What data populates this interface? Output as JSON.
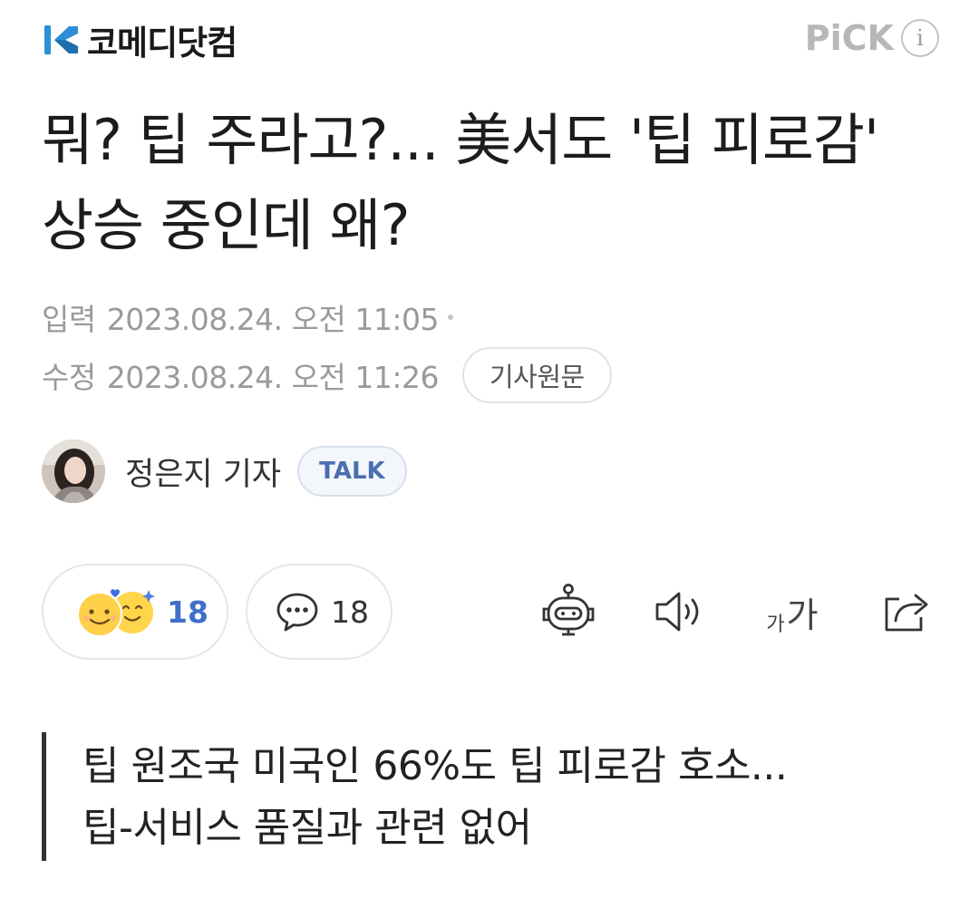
{
  "header": {
    "press_name": "코메디닷컴",
    "pick_label": "PiCK",
    "info_label": "i",
    "brand_color": "#2d8fd5"
  },
  "article": {
    "title": "뭐? 팁 주라고?... 美서도 '팁 피로감' 상승 중인데 왜?",
    "input_label": "입력",
    "input_date": "2023.08.24. 오전 11:05",
    "edit_label": "수정",
    "edit_date": "2023.08.24. 오전 11:26",
    "origin_button": "기사원문"
  },
  "reporter": {
    "name": "정은지 기자",
    "talk_label": "TALK"
  },
  "actions": {
    "reaction_count": "18",
    "comment_count": "18",
    "font_small": "가",
    "font_large": "가",
    "icons": [
      "reaction-emoji-icon",
      "comment-bubble-icon",
      "ai-bot-icon",
      "speaker-icon",
      "font-size-icon",
      "share-icon"
    ]
  },
  "summary": {
    "lines": [
      "팁 원조국 미국인 66%도 팁 피로감 호소...",
      "팁-서비스 품질과 관련 없어"
    ]
  }
}
